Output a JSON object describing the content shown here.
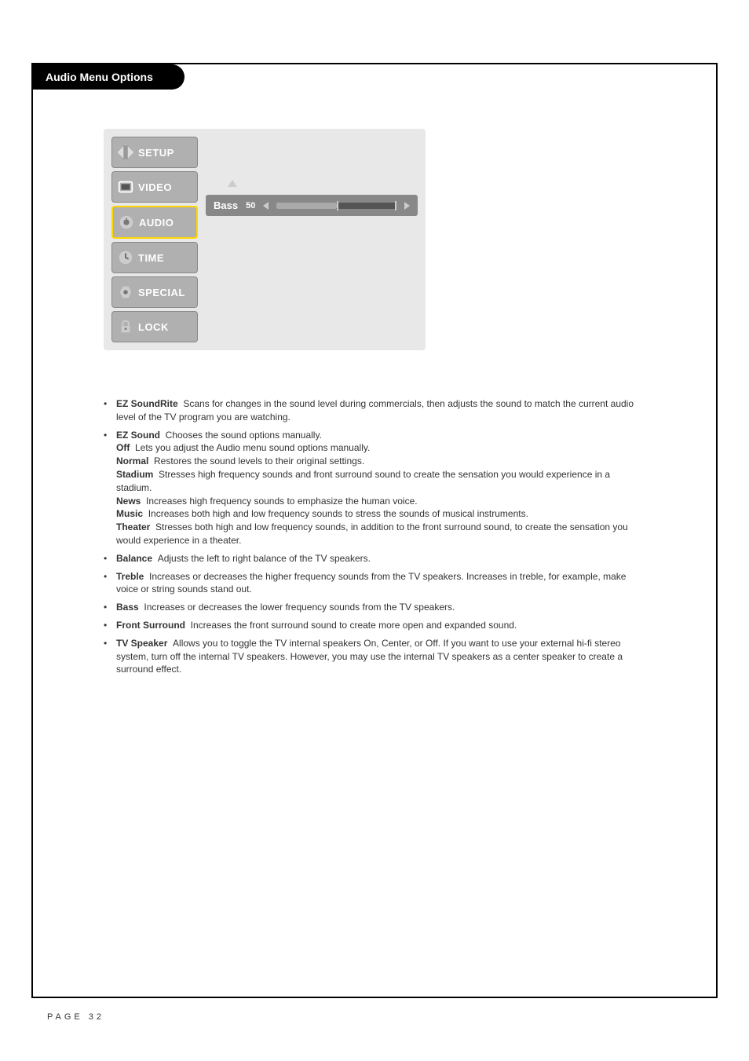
{
  "header": {
    "title": "Audio Menu Options"
  },
  "osd": {
    "sidebar": [
      {
        "label": "SETUP",
        "icon": "setup"
      },
      {
        "label": "VIDEO",
        "icon": "video"
      },
      {
        "label": "AUDIO",
        "icon": "audio",
        "selected": true
      },
      {
        "label": "TIME",
        "icon": "time"
      },
      {
        "label": "SPECIAL",
        "icon": "special"
      },
      {
        "label": "LOCK",
        "icon": "lock"
      }
    ],
    "slider": {
      "label": "Bass",
      "value": "50",
      "percent": 50
    }
  },
  "descriptions": {
    "ezSoundRite": {
      "title": "EZ SoundRite",
      "text": "Scans for changes in the sound level during commercials, then adjusts the sound to match the current audio level of the TV program you are watching."
    },
    "ezSound": {
      "title": "EZ Sound",
      "text": "Chooses the sound options manually.",
      "options": {
        "off": {
          "title": "Off",
          "text": "Lets you adjust the Audio menu sound options manually."
        },
        "normal": {
          "title": "Normal",
          "text": "Restores the sound levels to their original settings."
        },
        "stadium": {
          "title": "Stadium",
          "text": "Stresses high frequency sounds and front surround sound to create the sensation you would experience in a stadium."
        },
        "news": {
          "title": "News",
          "text": "Increases high frequency sounds to emphasize the human voice."
        },
        "music": {
          "title": "Music",
          "text": "Increases both high and low frequency sounds to stress the sounds of musical instruments."
        },
        "theater": {
          "title": "Theater",
          "text": "Stresses both high and low frequency sounds, in addition to the front surround sound, to create the sensation you would experience in a theater."
        }
      }
    },
    "balance": {
      "title": "Balance",
      "text": "Adjusts the left to right balance of the TV speakers."
    },
    "treble": {
      "title": "Treble",
      "text": "Increases or decreases the higher frequency sounds from the TV speakers. Increases in treble, for example, make voice or string sounds stand out."
    },
    "bass": {
      "title": "Bass",
      "text": "Increases or decreases the lower frequency sounds from the TV speakers."
    },
    "frontSurround": {
      "title": "Front Surround",
      "text": "Increases the front surround sound to create more open and expanded sound."
    },
    "tvSpeaker": {
      "title": "TV Speaker",
      "text": "Allows you to toggle the TV internal speakers On, Center, or Off. If you want to use your external hi-fi stereo system, turn off the internal TV speakers. However, you may use the internal TV speakers as a center speaker to create a surround effect."
    }
  },
  "footer": {
    "pageNumber": "PAGE 32"
  }
}
